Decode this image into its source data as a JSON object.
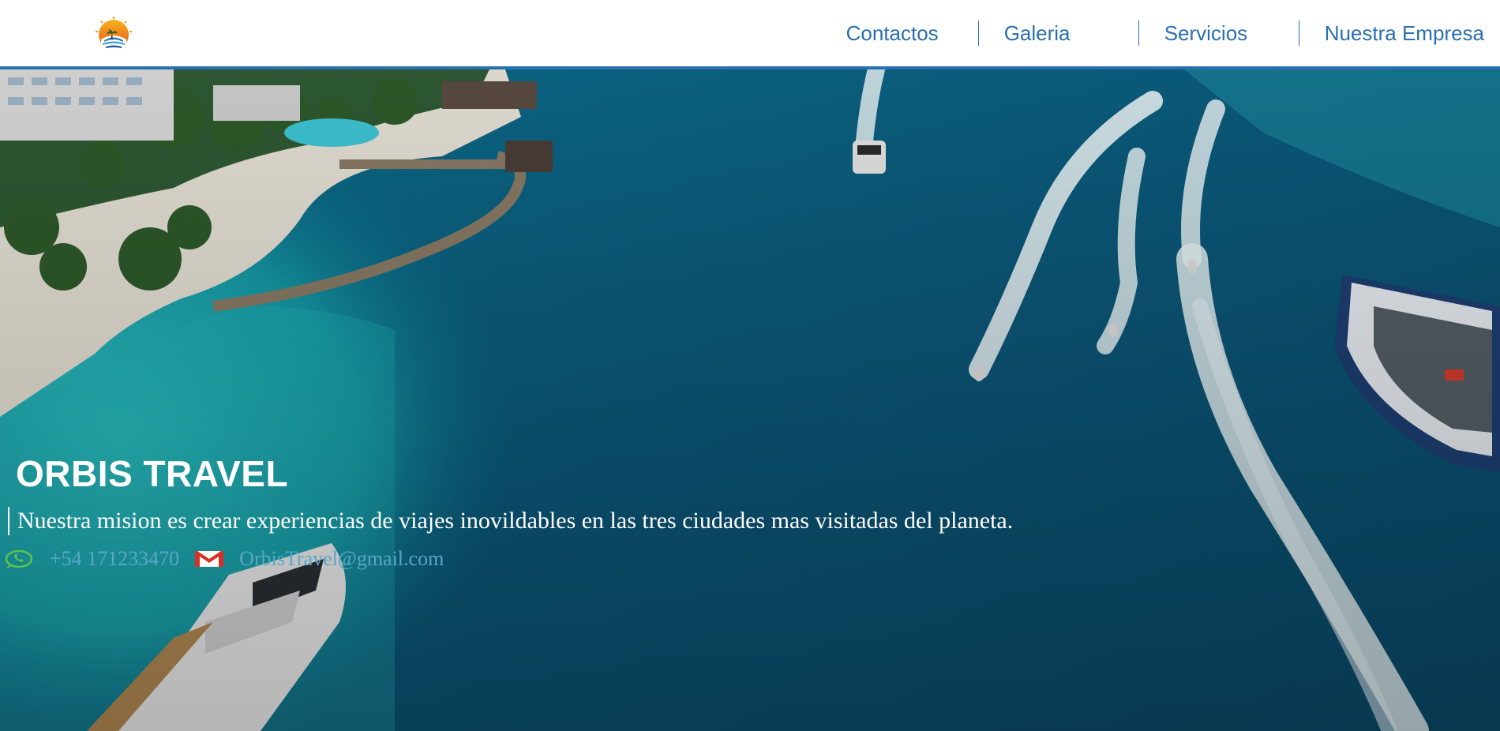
{
  "nav": {
    "items": [
      {
        "label": "Contactos"
      },
      {
        "label": "Galeria"
      },
      {
        "label": "Servicios"
      },
      {
        "label": "Nuestra Empresa"
      }
    ]
  },
  "hero": {
    "title": "ORBIS TRAVEL",
    "mission": "Nuestra mision es crear experiencias de viajes inovildables en las tres ciudades mas visitadas del planeta.",
    "phone": "+54 171233470",
    "email": "OrbisTravel@gmail.com"
  },
  "icons": {
    "logo": "sunset-island-logo-icon",
    "phone": "whatsapp-icon",
    "email": "gmail-icon"
  },
  "colors": {
    "nav_text": "#2a6fb0",
    "header_border": "#2a6fb0",
    "contact_text": "#5aa6c8",
    "whatsapp": "#5fc24c",
    "gmail": "#d93025"
  }
}
